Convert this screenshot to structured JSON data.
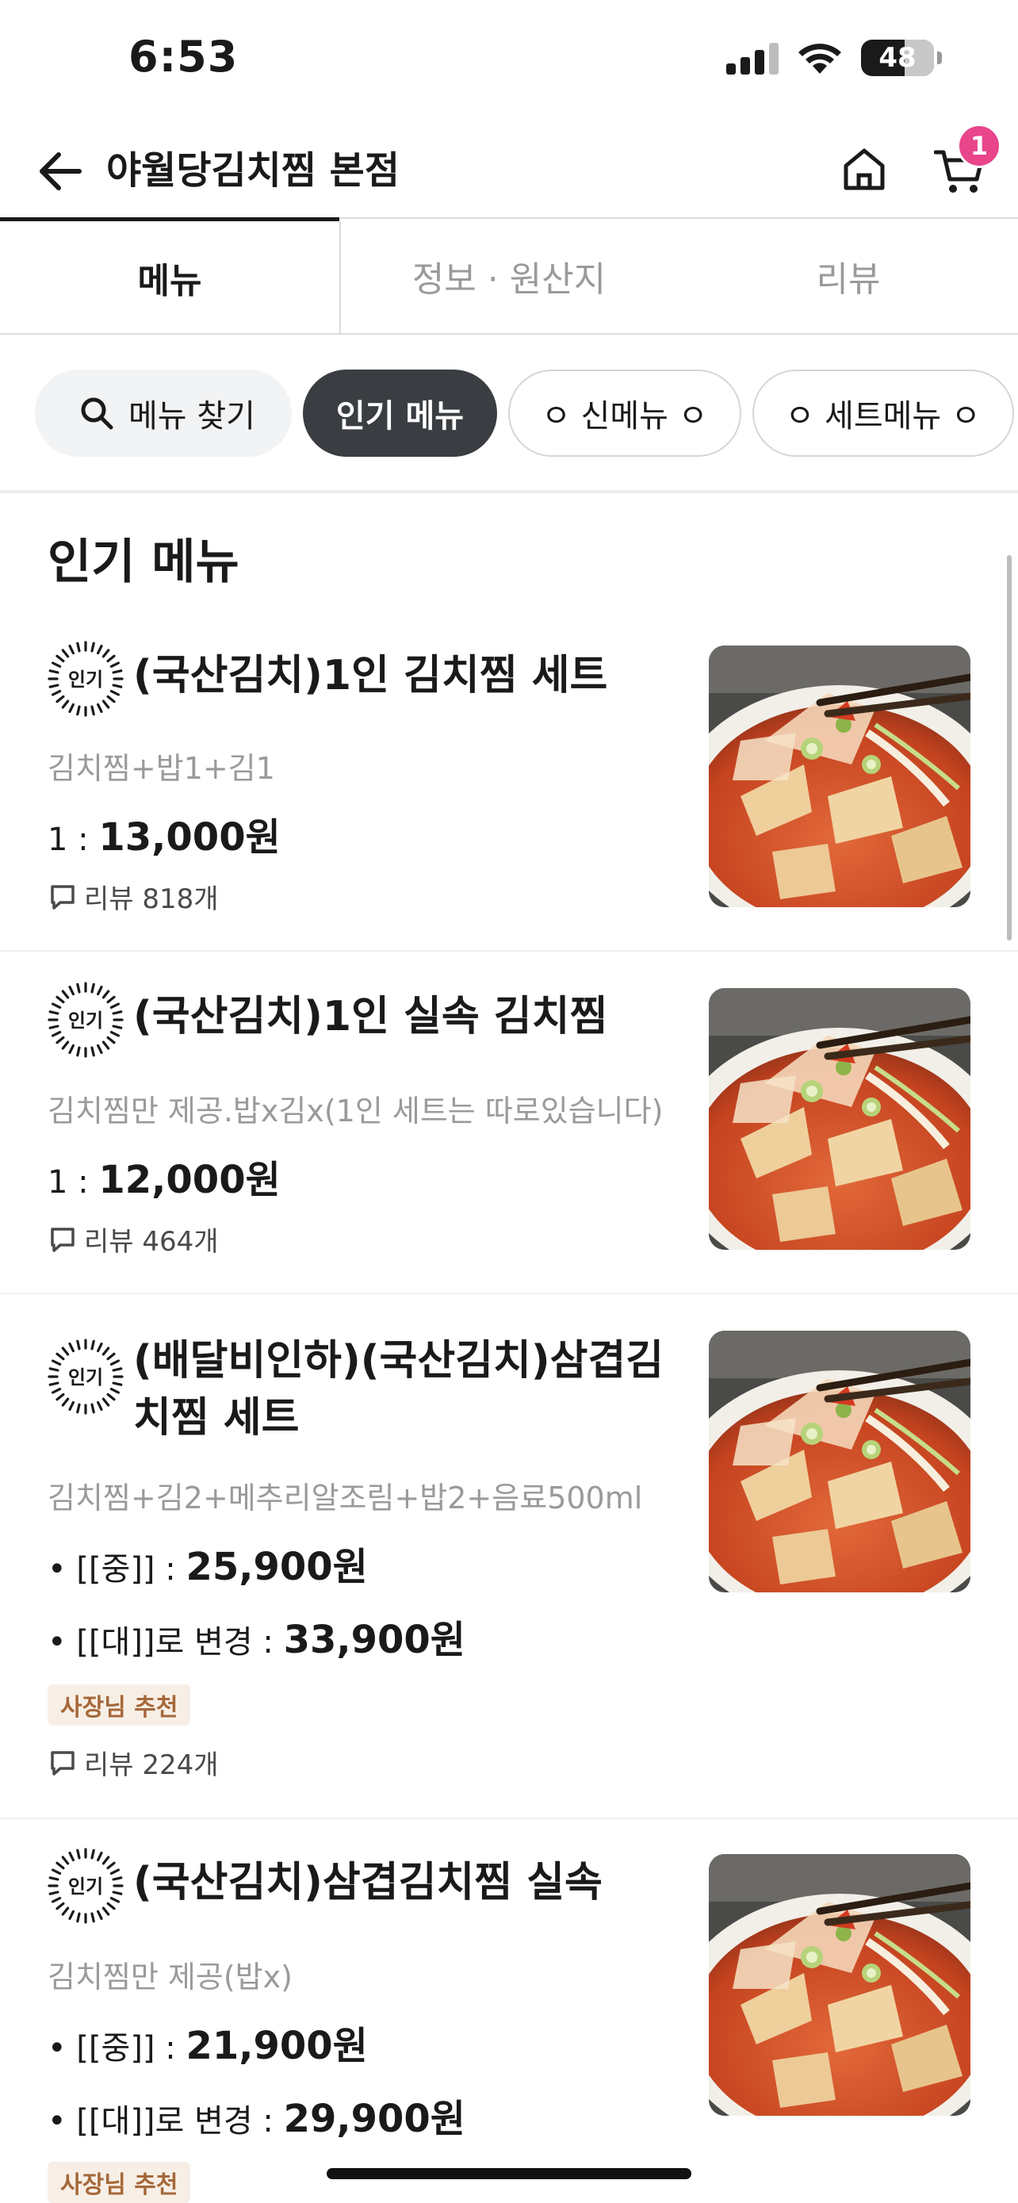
{
  "status_bar": {
    "time": "6:53",
    "battery": "48"
  },
  "header": {
    "title": "야월당김치찜 본점",
    "cart_count": "1"
  },
  "tabs": [
    {
      "label": "메뉴"
    },
    {
      "label": "정보 · 원산지"
    },
    {
      "label": "리뷰"
    }
  ],
  "chips": {
    "search": "메뉴 찾기",
    "items": [
      "인기 메뉴",
      "ㅇ 신메뉴 ㅇ",
      "ㅇ 세트메뉴 ㅇ"
    ]
  },
  "section_title": "인기 메뉴",
  "popular_badge": "인기",
  "menu": [
    {
      "name": "(국산김치)1인 김치찜 세트",
      "desc": "김치찜+밥1+김1",
      "prices": [
        {
          "label": "1 :",
          "amount": "13,000원"
        }
      ],
      "review": "리뷰 818개"
    },
    {
      "name": "(국산김치)1인 실속 김치찜",
      "desc": "김치찜만 제공.밥x김x(1인 세트는 따로있습니다)",
      "prices": [
        {
          "label": "1 :",
          "amount": "12,000원"
        }
      ],
      "review": "리뷰 464개"
    },
    {
      "name": "(배달비인하)(국산김치)삼겹김치찜 세트",
      "desc": "김치찜+김2+메추리알조림+밥2+음료500ml",
      "prices": [
        {
          "label": "• [[중]] :",
          "amount": "25,900원"
        },
        {
          "label": "• [[대]]로 변경 :",
          "amount": "33,900원"
        }
      ],
      "badge": "사장님 추천",
      "review": "리뷰 224개"
    },
    {
      "name": "(국산김치)삼겹김치찜 실속",
      "desc": "김치찜만 제공(밥x)",
      "prices": [
        {
          "label": "• [[중]] :",
          "amount": "21,900원"
        },
        {
          "label": "• [[대]]로 변경 :",
          "amount": "29,900원"
        }
      ],
      "badge": "사장님 추천"
    }
  ],
  "colors": {
    "accent_pink": "#e8458b",
    "chip_active": "#3a3d42",
    "badge_bg": "#f7efe6",
    "badge_text": "#a5683a"
  }
}
